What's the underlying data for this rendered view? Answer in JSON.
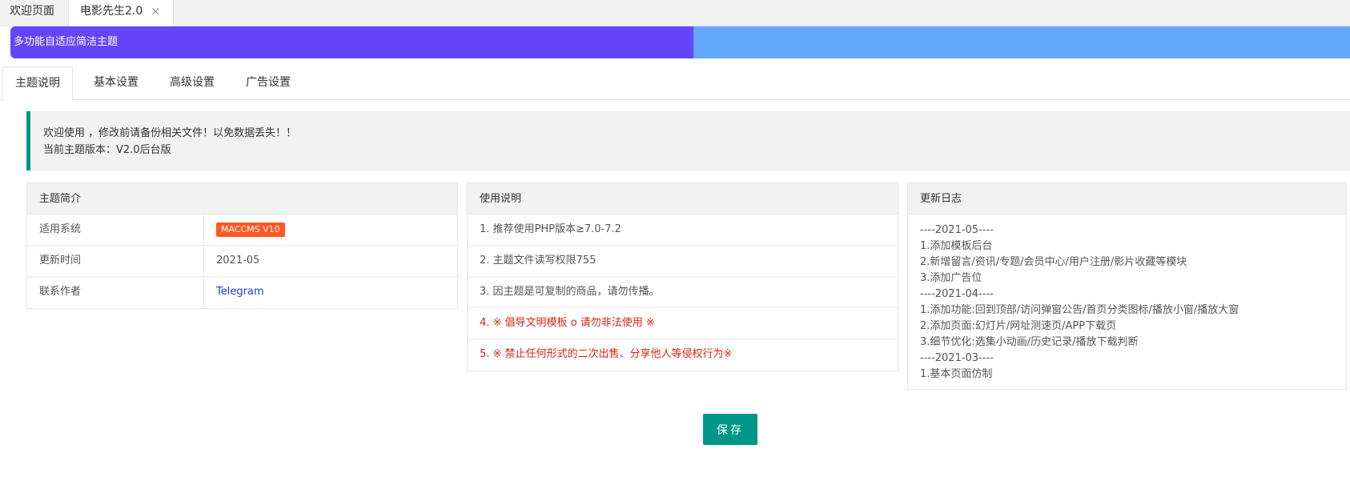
{
  "page_tabs": [
    {
      "label": "欢迎页面"
    },
    {
      "label": "电影先生2.0",
      "close": "×"
    }
  ],
  "banner": {
    "title": "多功能自适应简洁主题",
    "progress_fraction": 0.51
  },
  "settings_tabs": [
    {
      "label": "主题说明"
    },
    {
      "label": "基本设置"
    },
    {
      "label": "高级设置"
    },
    {
      "label": "广告设置"
    }
  ],
  "notice": {
    "line1": "欢迎使用 ，修改前请备份相关文件！以免数据丢失！！",
    "line2": "当前主题版本：V2.0后台版"
  },
  "intro": {
    "header": "主题简介",
    "rows": [
      {
        "label": "适用系统",
        "value": "MACCMS V10"
      },
      {
        "label": "更新时间",
        "value": "2021-05"
      },
      {
        "label": "联系作者",
        "value": "Telegram"
      }
    ]
  },
  "usage": {
    "header": "使用说明",
    "items": [
      "1. 推荐使用PHP版本≥7.0-7.2",
      "2. 主题文件读写权限755",
      "3. 因主题是可复制的商品，请勿传播。",
      "4. ※ 倡导文明模板 o 请勿非法使用 ※",
      "5. ※ 禁止任何形式的二次出售、分享他人等侵权行为※"
    ]
  },
  "changelog": {
    "header": "更新日志",
    "lines": [
      "----2021-05----",
      "1.添加模板后台",
      "2.新增留言/资讯/专题/会员中心/用户注册/影片收藏等模块",
      "3.添加广告位",
      "----2021-04----",
      "1.添加功能:回到顶部/访问弹窗公告/首页分类图标/播放小窗/播放大窗",
      "2.添加页面:幻灯片/网址测速页/APP下载页",
      "3.细节优化:选集小动画/历史记录/播放下载判断",
      "----2021-03----",
      "1.基本页面仿制"
    ]
  },
  "save_label": "保存",
  "colors": {
    "primary": "#009688",
    "banner_fill": "#6445fa",
    "banner_track": "#62a8fa",
    "badge": "#ff5722",
    "warn": "#d9240f"
  }
}
